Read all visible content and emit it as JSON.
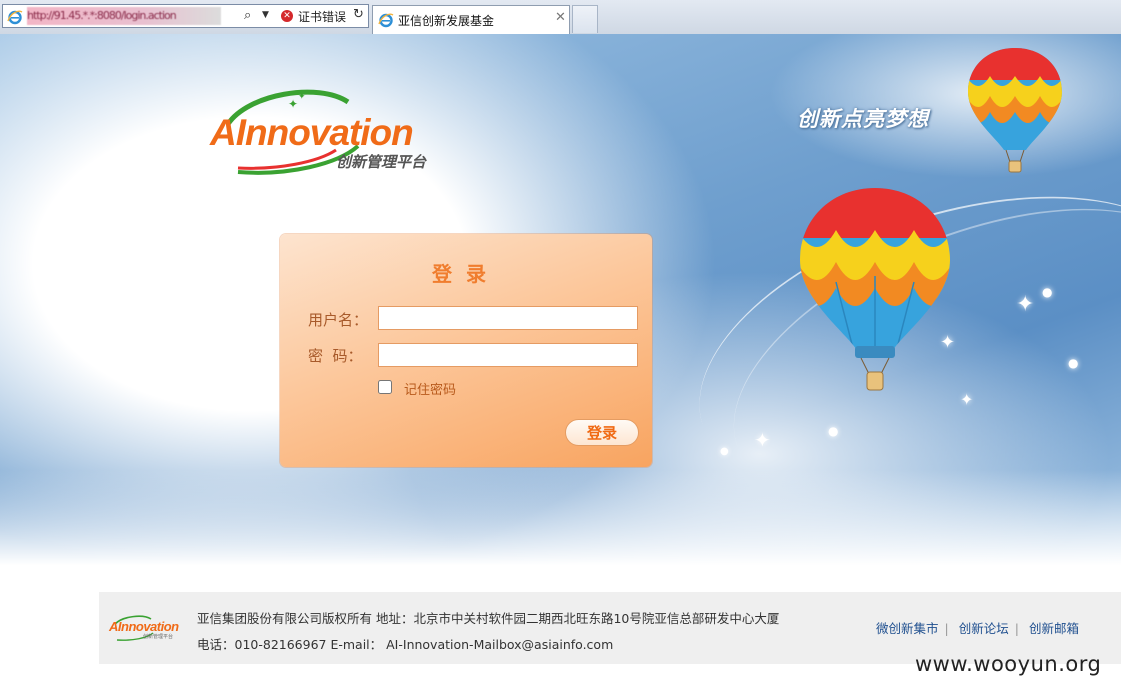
{
  "browser": {
    "address_bar": {
      "url_obscured": "http://91.45.*.*:8080/login.action",
      "cert_error_label": "证书错误"
    },
    "tab": {
      "title": "亚信创新发展基金"
    }
  },
  "hero": {
    "slogan": "创新点亮梦想"
  },
  "logo": {
    "text": "AInnovation",
    "subtitle": "创新管理平台"
  },
  "login": {
    "title": "登录",
    "username_label": "用户名：",
    "username_value": "",
    "password_label": "密  码：",
    "password_value": "",
    "remember_label": "记住密码",
    "remember_checked": false,
    "submit_label": "登录"
  },
  "footer": {
    "logo_text": "AInnovation",
    "logo_sub": "创新管理平台",
    "copyright": "亚信集团股份有限公司版权所有 地址：北京市中关村软件园二期西北旺东路10号院亚信总部研发中心大厦",
    "contact": "电话：010-82166967 E-mail： AI-Innovation-Mailbox@asiainfo.com",
    "links": [
      {
        "label": "微创新集市"
      },
      {
        "label": "创新论坛"
      },
      {
        "label": "创新邮箱"
      }
    ]
  },
  "watermark": "www.wooyun.org",
  "colors": {
    "brand_orange": "#f06b18",
    "brand_green": "#3aa232",
    "link_blue": "#1f4f8f"
  }
}
